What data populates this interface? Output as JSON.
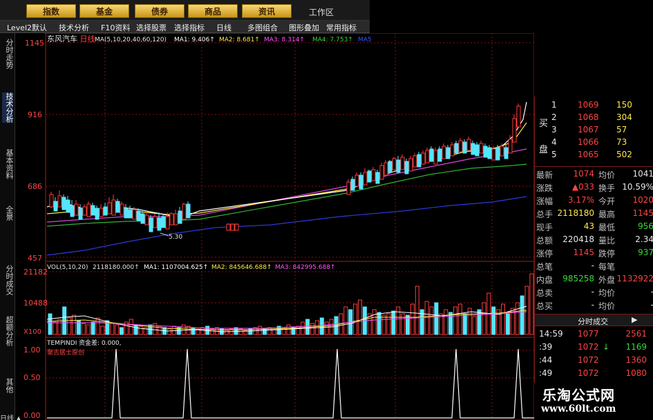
{
  "menu": {
    "items": [
      "指数",
      "基金",
      "债券",
      "商品",
      "资讯"
    ],
    "workspace": "工作区"
  },
  "toolbar": {
    "items": [
      "Level2默认",
      "技术分析",
      "F10资料",
      "选择股票",
      "选择指标",
      "日线",
      "多图组合",
      "图形叠加",
      "常用指标"
    ]
  },
  "left_tabs": [
    "分时走势",
    "技术分析",
    "基本资料",
    "全景"
  ],
  "left_tabs_lower": [
    "分时成交",
    "超额分析",
    "其他"
  ],
  "bottom_left_text": "日线 ▲",
  "kline": {
    "title": "东风汽车",
    "period": "日线",
    "ma_label": "MA(5,10,20,40,60,120)",
    "ma1": "MA1: 9.406↑",
    "ma2": "MA2: 8.681↑",
    "ma3": "MA3: 8.314↑",
    "ma4": "MA4: 7.753↑",
    "ma5": "MA5",
    "yticks": [
      "1145",
      "916",
      "686",
      "457"
    ],
    "low_marker": "5.30"
  },
  "volume": {
    "label": "VOL(5,10,20)",
    "value": "2118180.000↑",
    "ma1": "MA1: 1107004.625↑",
    "ma2": "MA2: 845646.688↑",
    "ma3": "MA3: 842995.688↑",
    "yticks": [
      "21182",
      "10488",
      "X100"
    ]
  },
  "indicator": {
    "label": "TEMPINDI",
    "value": "资金差: 0.000,",
    "sublabel": "聚吉居士原创",
    "yticks": [
      "1.00",
      "0.50",
      "0.00"
    ]
  },
  "order_book": {
    "buy_label_1": "买",
    "buy_label_2": "盘",
    "rows": [
      {
        "level": "1",
        "price": "1069",
        "vol": "150"
      },
      {
        "level": "2",
        "price": "1068",
        "vol": "304"
      },
      {
        "level": "3",
        "price": "1067",
        "vol": "57"
      },
      {
        "level": "4",
        "price": "1066",
        "vol": "73"
      },
      {
        "level": "5",
        "price": "1065",
        "vol": "502"
      }
    ]
  },
  "quote": [
    {
      "l": "最新",
      "v": "1074",
      "l2": "均价",
      "v2": "1041"
    },
    {
      "l": "涨跌",
      "v": "▲033",
      "l2": "换手",
      "v2": "10.59%"
    },
    {
      "l": "涨幅",
      "v": "3.17%",
      "l2": "今开",
      "v2": "1020"
    },
    {
      "l": "总手",
      "v": "2118180",
      "l2": "最高",
      "v2": "1145"
    },
    {
      "l": "现手",
      "v": "43",
      "l2": "最低",
      "v2": "956"
    },
    {
      "l": "总额",
      "v": "220418",
      "l2": "量比",
      "v2": "2.34"
    },
    {
      "l": "涨停",
      "v": "1145",
      "l2": "跌停",
      "v2": "937"
    },
    {
      "l": "总笔",
      "v": "-",
      "l2": "每笔",
      "v2": ""
    },
    {
      "l": "内盘",
      "v": "985258",
      "l2": "外盘",
      "v2": "1132922"
    },
    {
      "l": "总卖",
      "v": "-",
      "l2": "均价",
      "v2": "-"
    },
    {
      "l": "总买",
      "v": "-",
      "l2": "均价",
      "v2": "-"
    }
  ],
  "ticks": {
    "header": "分时成交",
    "rows": [
      {
        "t": "14:59",
        "p": "1077",
        "v": "2561",
        "dir": ""
      },
      {
        "t": ":39",
        "p": "1072",
        "v": "1169",
        "dir": "↓"
      },
      {
        "t": ":44",
        "p": "1072",
        "v": "1360",
        "dir": ""
      },
      {
        "t": ":49",
        "p": "1072",
        "v": "1080",
        "dir": ""
      }
    ]
  },
  "watermark": {
    "title": "乐淘公式网",
    "url": "www.60lt.com"
  },
  "colors": {
    "up": "#ff3b3b",
    "down": "#54e6ff",
    "ma1": "#ffffff",
    "ma2": "#ffe94a",
    "ma3": "#ff55ff",
    "ma4": "#38d838",
    "ma5": "#3355ff",
    "grid": "#8a1010",
    "axis": "#b01818"
  }
}
